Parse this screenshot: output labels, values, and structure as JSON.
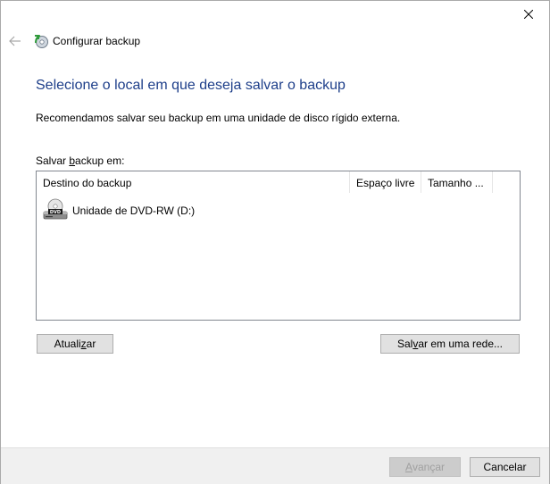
{
  "window": {
    "title": "Configurar backup"
  },
  "main": {
    "heading": "Selecione o local em que deseja salvar o backup",
    "description": "Recomendamos salvar seu backup em uma unidade de disco rígido externa.",
    "list_label_pre": "Salvar ",
    "list_label_underlined": "b",
    "list_label_post": "ackup em:"
  },
  "table": {
    "columns": [
      "Destino do backup",
      "Espaço livre",
      "Tamanho ..."
    ],
    "rows": [
      {
        "destination": "Unidade de DVD-RW (D:)",
        "free_space": "",
        "size": "",
        "icon": "dvd-drive-icon"
      }
    ]
  },
  "buttons": {
    "refresh_pre": "Atuali",
    "refresh_underlined": "z",
    "refresh_post": "ar",
    "network_pre": "Sal",
    "network_underlined": "v",
    "network_post": "ar em uma rede...",
    "next_underlined": "A",
    "next_post": "vançar",
    "cancel": "Cancelar"
  },
  "icons": {
    "close": "close-icon",
    "back": "back-arrow-icon",
    "app": "backup-icon",
    "dvd": "dvd-drive-icon"
  },
  "colors": {
    "heading": "#1e3f8a",
    "footer_bg": "#f0f0f0",
    "button_bg": "#e1e1e1",
    "disabled_text": "#a0a0a0"
  }
}
